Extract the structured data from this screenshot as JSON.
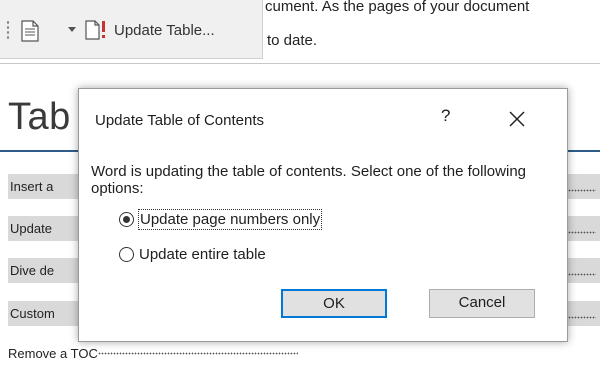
{
  "toolbar": {
    "doc_icon": "document-icon",
    "update_button_label": "Update Table..."
  },
  "document": {
    "text_line1": "cument. As the pages of your document",
    "text_line2": "to date.",
    "heading": "Tab",
    "toc_rows": [
      "Insert a",
      "Update",
      "Dive de",
      "Custom"
    ],
    "remove_row": "Remove a TOC"
  },
  "dialog": {
    "title": "Update Table of Contents",
    "help_label": "?",
    "close_icon": "close-icon",
    "message": "Word is updating the table of contents.  Select one of the following options:",
    "options": [
      {
        "label": "Update page numbers only",
        "selected": true
      },
      {
        "label": "Update entire table",
        "selected": false
      }
    ],
    "ok_label": "OK",
    "cancel_label": "Cancel"
  },
  "colors": {
    "accent": "#0078d7",
    "heading_rule": "#2e5b8a",
    "toc_highlight": "#d9d9d9"
  }
}
